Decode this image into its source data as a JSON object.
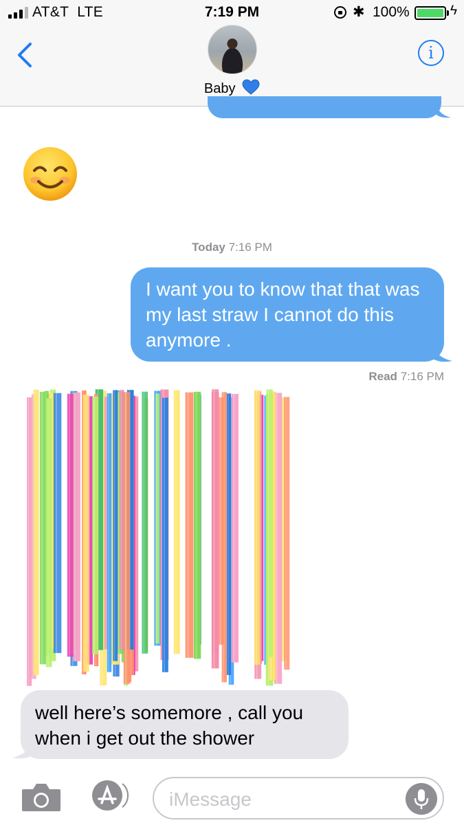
{
  "status_bar": {
    "carrier": "AT&T  LTE",
    "time": "7:19 PM",
    "bluetooth_glyph": "✱",
    "battery_percent": "100%",
    "battery_level": 1.0,
    "charge_glyph": "ϟ",
    "icons": [
      "signal-bars-icon",
      "orientation-lock-icon",
      "bluetooth-icon",
      "battery-icon",
      "charging-icon"
    ]
  },
  "header": {
    "contact_name": "Baby",
    "info_glyph": "i",
    "icons": [
      "back-chevron-icon",
      "contact-avatar",
      "blue-heart-icon",
      "info-icon"
    ]
  },
  "messages": {
    "emoji_message": {
      "emoji": "smiling-face-with-smiling-eyes-icon"
    },
    "timestamp": {
      "day": "Today",
      "time": "7:16 PM"
    },
    "outgoing_text": "I want you to know that that was my last straw I cannot do this anymore .",
    "read_receipt": {
      "label": "Read",
      "time": "7:16 PM"
    },
    "image_message": {
      "depicts": "colorful-drinking-straws-image"
    },
    "incoming_text": "well here’s somemore , call you when i get out the shower"
  },
  "input_bar": {
    "placeholder": "iMessage",
    "icons": [
      "camera-icon",
      "app-store-icon",
      "microphone-icon"
    ]
  },
  "colors": {
    "imessage_blue": "#5fa8f0",
    "incoming_gray": "#e5e5ea",
    "ios_link_blue": "#1f7cf3",
    "battery_green": "#4cd964",
    "meta_gray": "#8e8e93"
  }
}
